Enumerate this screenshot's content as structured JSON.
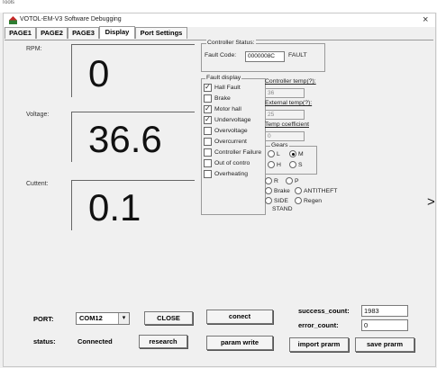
{
  "background": {
    "top_text": "Tools"
  },
  "window": {
    "title": "VOTOL-EM-V3 Software Debugging",
    "close": "×"
  },
  "tabs": [
    {
      "label": "PAGE1"
    },
    {
      "label": "PAGE2"
    },
    {
      "label": "PAGE3"
    },
    {
      "label": "Display"
    },
    {
      "label": "Port Settings"
    }
  ],
  "active_tab": "Display",
  "display": {
    "rpm_label": "RPM:",
    "rpm_value": "0",
    "voltage_label": "Voltage:",
    "voltage_value": "36.6",
    "current_label": "Cuttent:",
    "current_value": "0.1"
  },
  "controller_status": {
    "title": "Controller Status:",
    "fault_code_label": "Fault Code:",
    "fault_code_value": "0000008C",
    "fault_text": "FAULT"
  },
  "fault_display": {
    "title": "Fault display",
    "items": [
      {
        "label": "Hall Fault",
        "checked": true
      },
      {
        "label": "Brake",
        "checked": false
      },
      {
        "label": "Motor hall",
        "checked": true
      },
      {
        "label": "Undervoltage",
        "checked": true
      },
      {
        "label": "Overvoltage",
        "checked": false
      },
      {
        "label": "Overcurrent",
        "checked": false
      },
      {
        "label": "Controller Failure",
        "checked": false
      },
      {
        "label": "Out of contro",
        "checked": false
      },
      {
        "label": "Overheating",
        "checked": false
      }
    ]
  },
  "temps": {
    "controller_temp_label": "Controller temp(?):",
    "controller_temp_value": "36",
    "external_temp_label": "External temp(?):",
    "external_temp_value": "25",
    "temp_coeff_label": "Temp coefficient",
    "temp_coeff_value": "0"
  },
  "gears": {
    "title": "Gears",
    "L": "L",
    "M": "M",
    "H": "H",
    "S": "S",
    "selected": "M"
  },
  "mode": {
    "R": "R",
    "P": "P",
    "brake": "Brake",
    "antitheft": "ANTITHEFT",
    "side": "SIDE",
    "regen": "Regen",
    "stand": "STAND"
  },
  "nav_arrow": ">",
  "port": {
    "port_label": "PORT:",
    "port_value": "COM12",
    "close_btn": "CLOSE",
    "status_label": "status:",
    "status_value": "Connected",
    "research_btn": "research"
  },
  "actions": {
    "conect": "conect",
    "param_write": "param write",
    "import_prarm": "import prarm",
    "save_prarm": "save prarm"
  },
  "counts": {
    "success_label": "success_count:",
    "success_value": "1983",
    "error_label": "error_count:",
    "error_value": "0"
  },
  "colors": {
    "window_bg": "#f0f0f0",
    "title_bg": "#ffffff"
  }
}
